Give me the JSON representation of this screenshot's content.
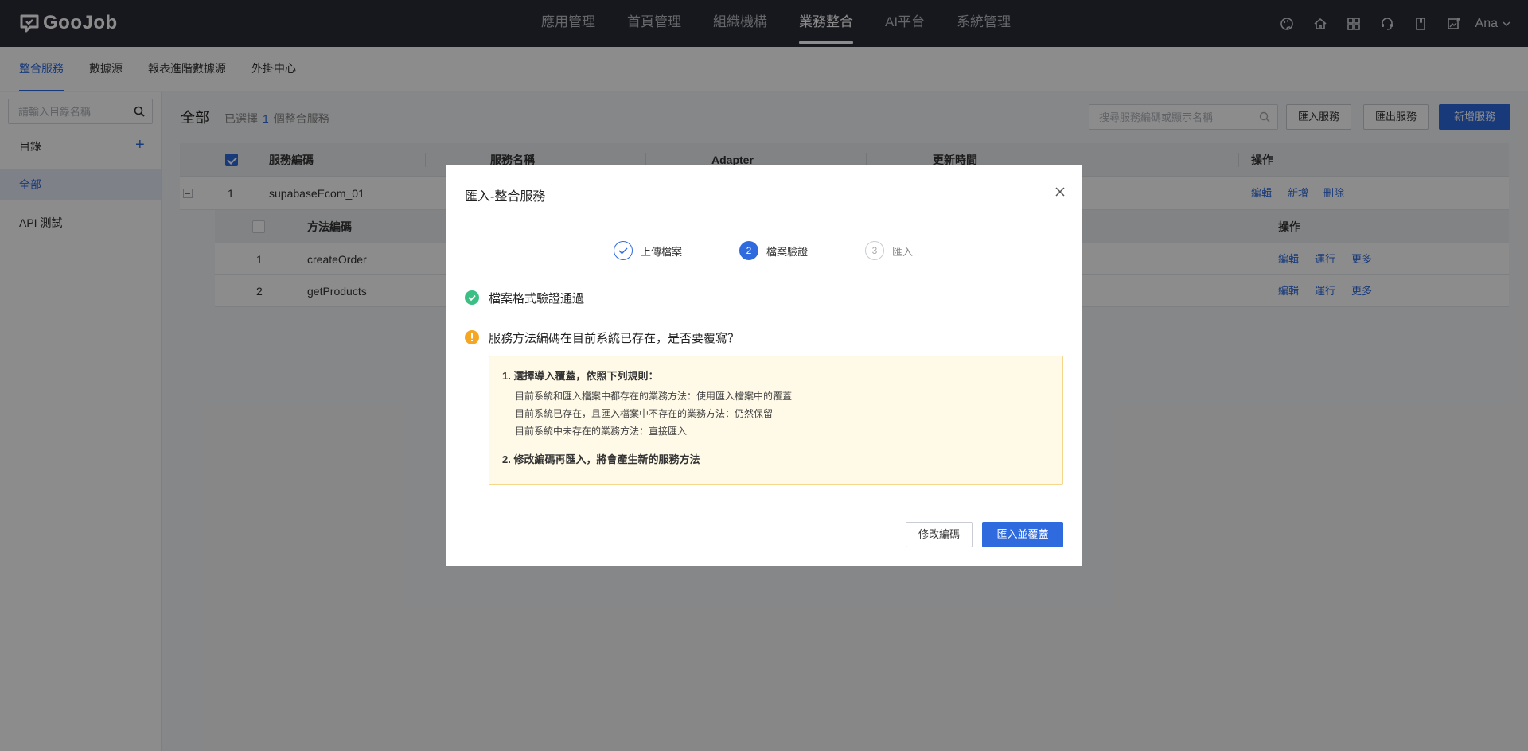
{
  "brand": {
    "logo_text": "GooJob"
  },
  "topnav": {
    "menu": [
      "應用管理",
      "首頁管理",
      "組織機構",
      "業務整合",
      "AI平台",
      "系統管理"
    ],
    "active_index": 3,
    "user": "Ana"
  },
  "subnav": {
    "items": [
      "整合服務",
      "數據源",
      "報表進階數據源",
      "外掛中心"
    ],
    "active_index": 0
  },
  "sidebar": {
    "search_placeholder": "請輸入目錄名稱",
    "dir_label": "目錄",
    "items": [
      "全部",
      "API 測試"
    ]
  },
  "main": {
    "title": "全部",
    "selected_prefix": "已選擇",
    "selected_count": "1",
    "selected_suffix": "個整合服務",
    "search_placeholder": "搜尋服務編碼或顯示名稱",
    "buttons": {
      "import": "匯入服務",
      "export": "匯出服務",
      "add": "新增服務"
    }
  },
  "table": {
    "headers": [
      "服務編碼",
      "服務名稱",
      "Adapter",
      "更新時間",
      "操作"
    ],
    "row": {
      "index": "1",
      "code": "supabaseEcom_01",
      "actions": [
        "編輯",
        "新增",
        "刪除"
      ]
    },
    "sub_headers": [
      "方法編碼",
      "操作"
    ],
    "sub_rows": [
      {
        "index": "1",
        "code": "createOrder",
        "actions": [
          "編輯",
          "運行",
          "更多"
        ]
      },
      {
        "index": "2",
        "code": "getProducts",
        "actions": [
          "編輯",
          "運行",
          "更多"
        ]
      }
    ]
  },
  "modal": {
    "title": "匯入-整合服務",
    "steps": [
      {
        "label": "上傳檔案",
        "num": "1",
        "state": "done"
      },
      {
        "label": "檔案驗證",
        "num": "2",
        "state": "active"
      },
      {
        "label": "匯入",
        "num": "3",
        "state": "pending"
      }
    ],
    "check_msg": "檔案格式驗證通過",
    "warn_msg": "服務方法編碼在目前系統已存在，是否要覆寫？",
    "note": {
      "h1": "1. 選擇導入覆蓋，依照下列規則：",
      "rules": [
        "目前系統和匯入檔案中都存在的業務方法：使用匯入檔案中的覆蓋",
        "目前系統已存在，且匯入檔案中不存在的業務方法：仍然保留",
        "目前系統中未存在的業務方法：直接匯入"
      ],
      "h2": "2. 修改編碼再匯入，將會產生新的服務方法"
    },
    "buttons": {
      "modify": "修改編碼",
      "import_overwrite": "匯入並覆蓋"
    }
  },
  "colors": {
    "primary": "#2f6bde",
    "success": "#3bbf84",
    "warning": "#f5a623",
    "nav_bg": "#2b2d36"
  }
}
